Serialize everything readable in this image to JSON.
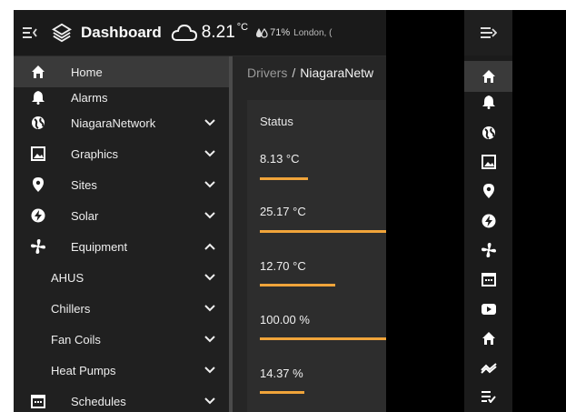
{
  "header": {
    "title": "Dashboard",
    "temperature": "8.21",
    "temperature_unit": "°C",
    "humidity": "71%",
    "location": "London, ("
  },
  "sidebar": {
    "items": [
      {
        "label": "Home",
        "icon": "home-icon",
        "active": true
      },
      {
        "label": "Alarms",
        "icon": "bell-icon"
      },
      {
        "label": "NiagaraNetwork",
        "icon": "globe-icon",
        "chevron": "down"
      },
      {
        "label": "Graphics",
        "icon": "image-icon",
        "chevron": "down"
      },
      {
        "label": "Sites",
        "icon": "map-pin-icon",
        "chevron": "down"
      },
      {
        "label": "Solar",
        "icon": "bolt-icon",
        "chevron": "down"
      },
      {
        "label": "Equipment",
        "icon": "fan-icon",
        "chevron": "up"
      },
      {
        "label": "AHUS",
        "chevron": "down",
        "sub": true
      },
      {
        "label": "Chillers",
        "chevron": "down",
        "sub": true
      },
      {
        "label": "Fan Coils",
        "chevron": "down",
        "sub": true
      },
      {
        "label": "Heat Pumps",
        "chevron": "down",
        "sub": true
      },
      {
        "label": "Schedules",
        "icon": "calendar-icon",
        "chevron": "down"
      }
    ]
  },
  "breadcrumb": {
    "part1": "Drivers",
    "separator": "/",
    "part2": "NiagaraNetw"
  },
  "status_card": {
    "header": "Status",
    "rows": [
      {
        "value": "8.13 °C",
        "bar_fraction": 0.38
      },
      {
        "value": "25.17 °C",
        "bar_fraction": 1.0
      },
      {
        "value": "12.70 °C",
        "bar_fraction": 0.6
      },
      {
        "value": "100.00 %",
        "bar_fraction": 1.0
      },
      {
        "value": "14.37 %",
        "bar_fraction": 0.35
      }
    ]
  },
  "rail": {
    "icons": [
      "home-icon",
      "bell-icon",
      "globe-icon",
      "image-icon",
      "map-pin-icon",
      "bolt-icon",
      "fan-icon",
      "calendar-icon",
      "youtube-icon",
      "home-icon",
      "trend-icon",
      "list-check-icon"
    ]
  },
  "colors": {
    "accent": "#f0a43a",
    "panel": "#202020",
    "active": "#3a3a3a"
  }
}
